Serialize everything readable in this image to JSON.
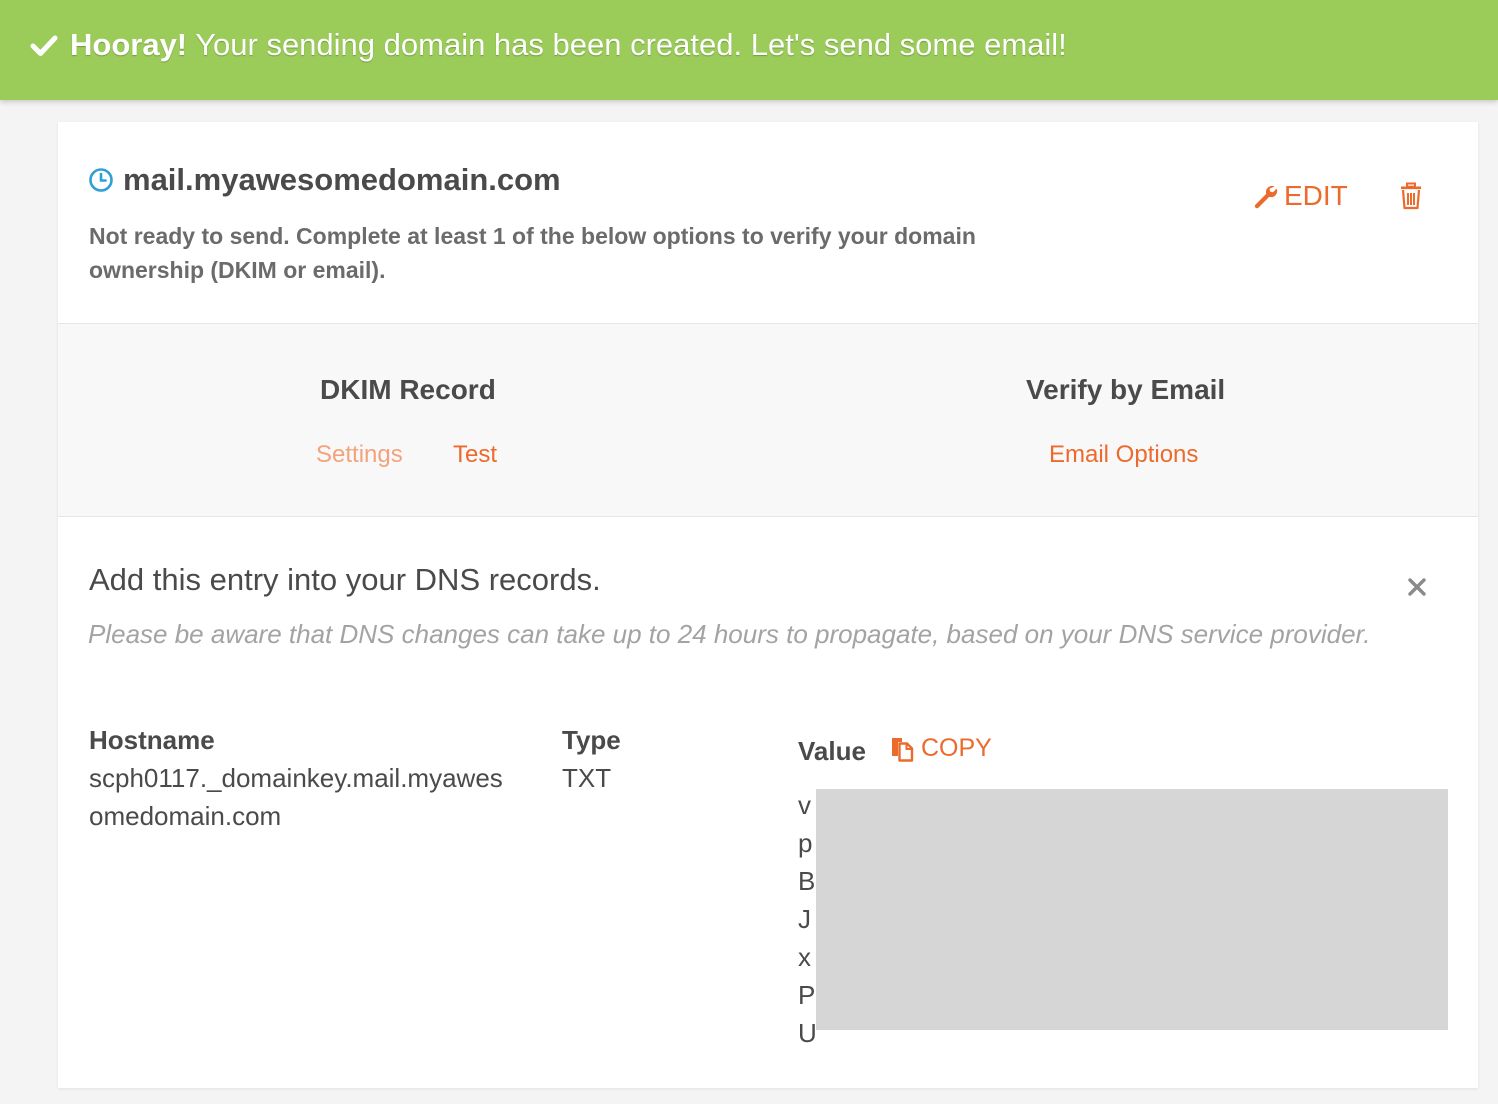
{
  "banner": {
    "icon": "check-icon",
    "strong": "Hooray!",
    "message": " Your sending domain has been created. Let's send some email!",
    "color": "#9bcc5a"
  },
  "domain": {
    "status_icon": "clock-icon",
    "name": "mail.myawesomedomain.com",
    "status": "Not ready to send. Complete at least 1 of the below options to verify your domain ownership (DKIM or email).",
    "edit_label": "EDIT",
    "edit_icon": "wrench-icon",
    "delete_icon": "trash-icon"
  },
  "options": {
    "dkim": {
      "title": "DKIM Record",
      "links": [
        "Settings",
        "Test"
      ],
      "active": "Settings"
    },
    "email": {
      "title": "Verify by Email",
      "links": [
        "Email Options"
      ]
    }
  },
  "dns": {
    "title": "Add this entry into your DNS records.",
    "note": "Please be aware that DNS changes can take up to 24 hours to propagate, based on your DNS service provider.",
    "close_icon": "close-icon",
    "columns": {
      "hostname": "Hostname",
      "type": "Type",
      "value": "Value"
    },
    "record": {
      "hostname": "scph0117._domainkey.mail.myawesomedomain.com",
      "type": "TXT",
      "value_lines": [
        "v",
        "p",
        "B",
        "J",
        "x",
        "P",
        "U"
      ]
    },
    "copy_label": "COPY",
    "copy_icon": "copy-icon"
  },
  "colors": {
    "accent": "#ec6a2c",
    "accent_light": "#f3a37c",
    "info": "#2f9fd8",
    "redacted": "#d6d6d6"
  }
}
